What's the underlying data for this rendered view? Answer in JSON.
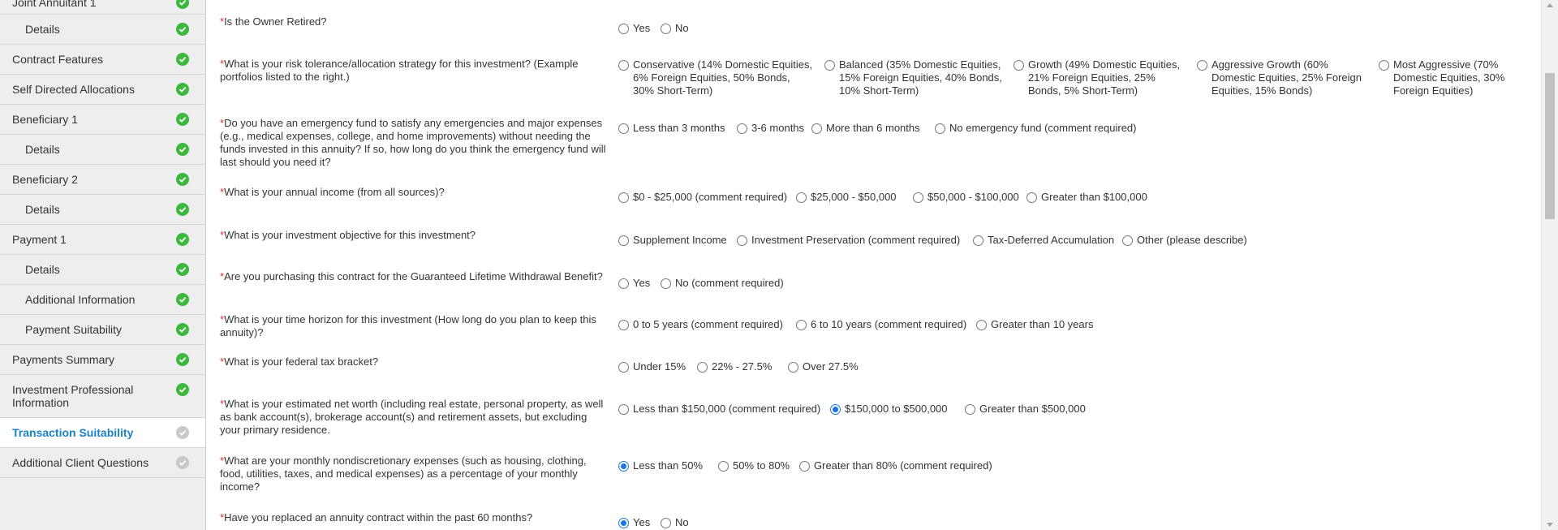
{
  "sidebar": {
    "items": [
      {
        "label": "Joint Annuitant 1",
        "status": "complete"
      },
      {
        "label": "Details",
        "status": "complete"
      },
      {
        "label": "Contract Features",
        "status": "complete"
      },
      {
        "label": "Self Directed Allocations",
        "status": "complete"
      },
      {
        "label": "Beneficiary 1",
        "status": "complete"
      },
      {
        "label": "Details",
        "status": "complete"
      },
      {
        "label": "Beneficiary 2",
        "status": "complete"
      },
      {
        "label": "Details",
        "status": "complete"
      },
      {
        "label": "Payment 1",
        "status": "complete"
      },
      {
        "label": "Details",
        "status": "complete"
      },
      {
        "label": "Additional Information",
        "status": "complete"
      },
      {
        "label": "Payment Suitability",
        "status": "complete"
      },
      {
        "label": "Payments Summary",
        "status": "complete"
      },
      {
        "label": "Investment Professional Information",
        "status": "complete"
      },
      {
        "label": "Transaction Suitability",
        "status": "pending"
      },
      {
        "label": "Additional Client Questions",
        "status": "pending"
      }
    ]
  },
  "required_marker": "*",
  "questions": [
    {
      "text": "Is the Owner Retired?",
      "options": [
        {
          "label": "Yes"
        },
        {
          "label": "No"
        }
      ]
    },
    {
      "text": "What is your risk tolerance/allocation strategy for this investment? (Example portfolios listed to the right.)",
      "options": [
        {
          "label": "Conservative (14% Domestic Equities, 6% Foreign Equities, 50% Bonds, 30% Short-Term)"
        },
        {
          "label": "Balanced (35% Domestic Equities, 15% Foreign Equities, 40% Bonds, 10% Short-Term)"
        },
        {
          "label": "Growth (49% Domestic Equities, 21% Foreign Equities, 25% Bonds, 5% Short-Term)"
        },
        {
          "label": "Aggressive Growth (60% Domestic Equities, 25% Foreign Equities, 15% Bonds)"
        },
        {
          "label": "Most Aggressive (70% Domestic Equities, 30% Foreign Equities)"
        }
      ]
    },
    {
      "text": "Do you have an emergency fund to satisfy any emergencies and major expenses (e.g., medical expenses, college, and home improvements) without needing the funds invested in this annuity? If so, how long do you think the emergency fund will last should you need it?",
      "options": [
        {
          "label": "Less than 3 months"
        },
        {
          "label": "3-6 months"
        },
        {
          "label": "More than 6 months"
        },
        {
          "label": "No emergency fund (comment required)"
        }
      ]
    },
    {
      "text": "What is your annual income (from all sources)?",
      "options": [
        {
          "label": "$0 - $25,000 (comment required)"
        },
        {
          "label": "$25,000 - $50,000"
        },
        {
          "label": "$50,000 - $100,000"
        },
        {
          "label": "Greater than $100,000"
        }
      ]
    },
    {
      "text": "What is your investment objective for this investment?",
      "options": [
        {
          "label": "Supplement Income"
        },
        {
          "label": "Investment Preservation (comment required)"
        },
        {
          "label": "Tax-Deferred Accumulation"
        },
        {
          "label": "Other (please describe)"
        }
      ]
    },
    {
      "text": "Are you purchasing this contract for the Guaranteed Lifetime Withdrawal Benefit?",
      "options": [
        {
          "label": "Yes"
        },
        {
          "label": "No (comment required)"
        }
      ]
    },
    {
      "text": "What is your time horizon for this investment (How long do you plan to keep this annuity)?",
      "options": [
        {
          "label": "0 to 5 years (comment required)"
        },
        {
          "label": "6 to 10 years (comment required)"
        },
        {
          "label": "Greater than 10 years"
        }
      ]
    },
    {
      "text": "What is your federal tax bracket?",
      "options": [
        {
          "label": "Under 15%"
        },
        {
          "label": "22% - 27.5%"
        },
        {
          "label": "Over 27.5%"
        }
      ]
    },
    {
      "text": "What is your estimated net worth (including real estate, personal property, as well as bank account(s), brokerage account(s) and retirement assets, but excluding your primary residence.",
      "options": [
        {
          "label": "Less than $150,000 (comment required)"
        },
        {
          "label": "$150,000 to $500,000",
          "selected": true
        },
        {
          "label": "Greater than $500,000"
        }
      ]
    },
    {
      "text": "What are your monthly nondiscretionary expenses (such as housing, clothing, food, utilities, taxes, and medical expenses) as a percentage of your monthly income?",
      "options": [
        {
          "label": "Less than 50%",
          "selected": true
        },
        {
          "label": "50% to 80%"
        },
        {
          "label": "Greater than 80% (comment required)"
        }
      ]
    },
    {
      "text": "Have you replaced an annuity contract within the past 60 months?",
      "options": [
        {
          "label": "Yes",
          "selected": true
        },
        {
          "label": "No"
        }
      ]
    }
  ],
  "colors": {
    "accent": "#1a82c9",
    "complete": "#3cb83c",
    "pending": "#c9c9c9",
    "required": "#d9302c"
  }
}
